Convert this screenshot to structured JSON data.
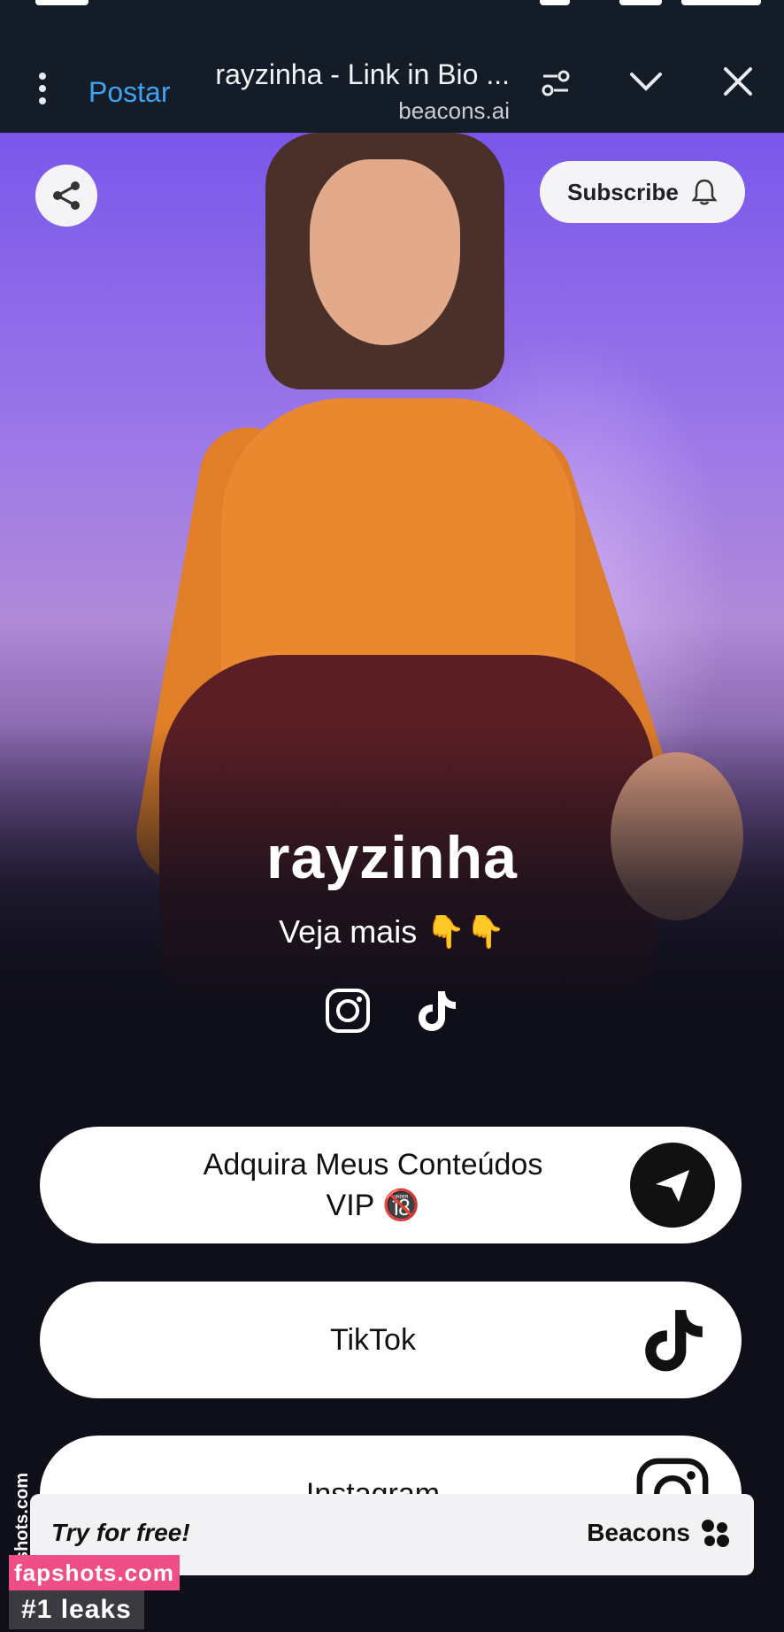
{
  "browser": {
    "title": "rayzinha - Link in Bio ...",
    "domain": "beacons.ai",
    "action_label": "Postar"
  },
  "profile": {
    "subscribe_label": "Subscribe",
    "name": "rayzinha",
    "bio": "Veja mais 👇👇",
    "social_icons": [
      "tiktok-icon",
      "instagram-icon"
    ]
  },
  "links": [
    {
      "line1": "Adquira Meus Conteúdos",
      "line2": "VIP 🔞",
      "icon": "send-icon"
    },
    {
      "line1": "TikTok",
      "icon": "tiktok-icon"
    },
    {
      "line1": "Instagram",
      "icon": "instagram-icon"
    }
  ],
  "footer": {
    "brand": "Beacons",
    "cta": "Try for free!"
  },
  "watermark": {
    "side": "fapshots.com",
    "site": "fapshots.com",
    "tagline": "#1 leaks"
  },
  "colors": {
    "toolbar_bg": "#141d27",
    "accent_blue": "#3ea3f2",
    "page_bg": "#0f0f1a",
    "watermark_pink": "#ef4d86"
  }
}
